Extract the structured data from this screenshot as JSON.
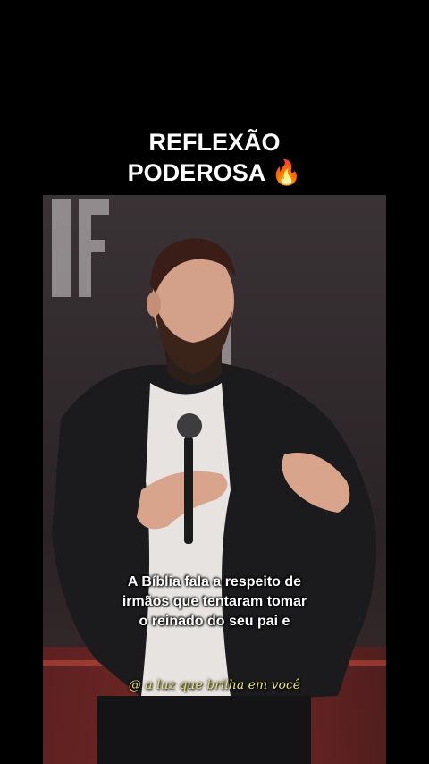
{
  "title": {
    "line1": "REFLEXÃO",
    "line2": "PODEROSA 🔥"
  },
  "caption": {
    "line1": "A Bíblia fala a respeito de",
    "line2": "irmãos que tentaram tomar",
    "line3": "o reinado do seu pai e"
  },
  "watermark": "@ a luz que brilha em você",
  "colors": {
    "background": "#000000",
    "title_text": "#ffffff",
    "caption_text": "#ffffff",
    "watermark_text": "#e8e07a"
  }
}
